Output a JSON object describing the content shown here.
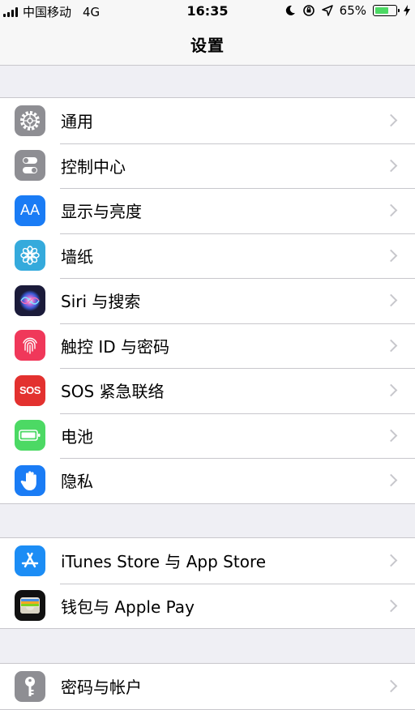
{
  "status_bar": {
    "carrier": "中国移动",
    "network": "4G",
    "time": "16:35",
    "battery_percent": "65%",
    "battery_level": 0.65,
    "battery_color": "#4cd964"
  },
  "nav": {
    "title": "设置"
  },
  "groups": [
    {
      "rows": [
        {
          "label": "通用",
          "icon": "gear-icon",
          "icon_bg": "#8e8e93"
        },
        {
          "label": "控制中心",
          "icon": "toggles-icon",
          "icon_bg": "#8e8e93"
        },
        {
          "label": "显示与亮度",
          "icon": "text-size-icon",
          "icon_text": "AA",
          "icon_bg": "#1a7cf5"
        },
        {
          "label": "墙纸",
          "icon": "flower-icon",
          "icon_bg": "#35aadc"
        },
        {
          "label": "Siri 与搜索",
          "icon": "siri-icon",
          "icon_bg": "#1b1b3a"
        },
        {
          "label": "触控 ID 与密码",
          "icon": "fingerprint-icon",
          "icon_bg": "#f0385a"
        },
        {
          "label": "SOS 紧急联络",
          "icon": "sos-icon",
          "icon_text": "SOS",
          "icon_bg": "#e3312f"
        },
        {
          "label": "电池",
          "icon": "battery-icon",
          "icon_bg": "#4cd964"
        },
        {
          "label": "隐私",
          "icon": "hand-icon",
          "icon_bg": "#1a7cf5"
        }
      ]
    },
    {
      "rows": [
        {
          "label": "iTunes Store 与 App Store",
          "icon": "app-store-icon",
          "icon_bg": "#1c8df5"
        },
        {
          "label": "钱包与 Apple Pay",
          "icon": "wallet-icon",
          "icon_bg": "#111111"
        }
      ]
    },
    {
      "rows": [
        {
          "label": "密码与帐户",
          "icon": "key-icon",
          "icon_bg": "#8e8e93"
        }
      ]
    }
  ]
}
